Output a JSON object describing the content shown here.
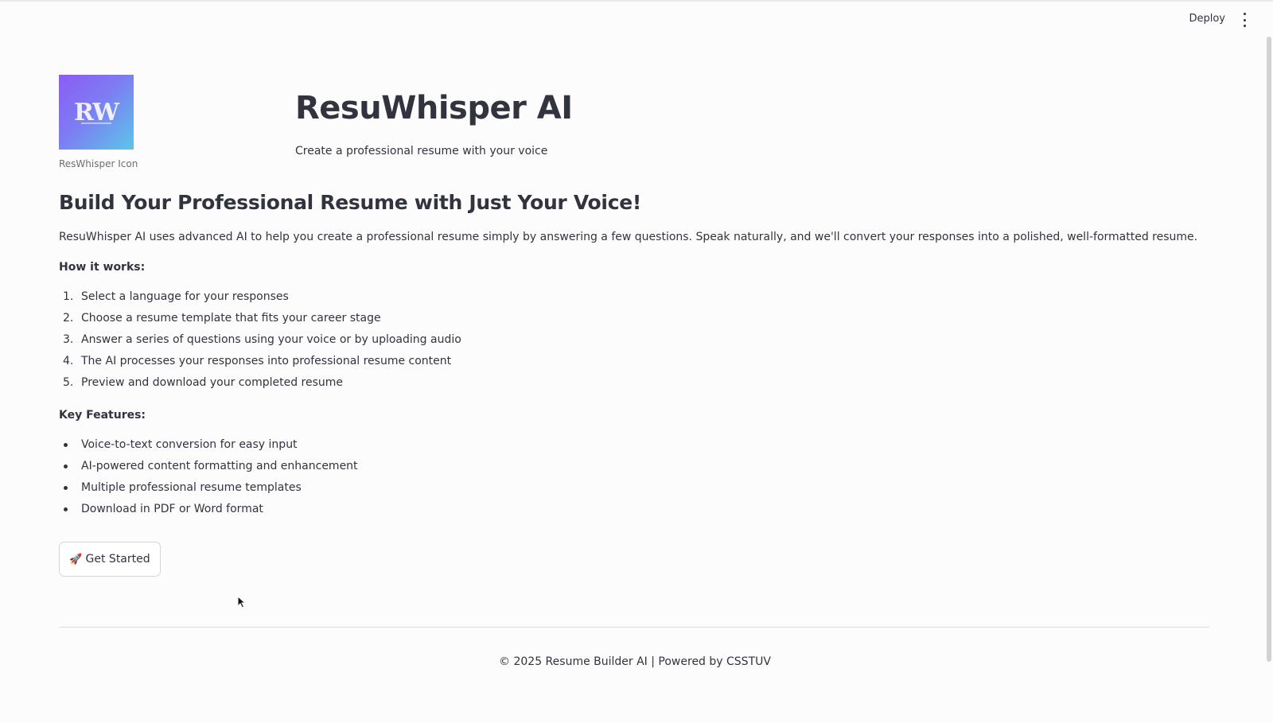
{
  "header": {
    "deploy_label": "Deploy",
    "menu_icon": "kebab-menu-icon"
  },
  "brand": {
    "logo_text": "RW",
    "logo_caption": "ResWhisper Icon",
    "app_title": "ResuWhisper AI",
    "app_subtitle": "Create a professional resume with your voice",
    "logo_gradient": [
      "#8b5cf6",
      "#5bc6e8"
    ]
  },
  "main": {
    "headline": "Build Your Professional Resume with Just Your Voice!",
    "intro": "ResuWhisper AI uses advanced AI to help you create a professional resume simply by answering a few questions. Speak naturally, and we'll convert your responses into a polished, well-formatted resume.",
    "how_label": "How it works:",
    "steps": [
      {
        "num": "1.",
        "text": "Select a language for your responses"
      },
      {
        "num": "2.",
        "text": "Choose a resume template that fits your career stage"
      },
      {
        "num": "3.",
        "text": "Answer a series of questions using your voice or by uploading audio"
      },
      {
        "num": "4.",
        "text": "The AI processes your responses into professional resume content"
      },
      {
        "num": "5.",
        "text": "Preview and download your completed resume"
      }
    ],
    "features_label": "Key Features:",
    "features": [
      "Voice-to-text conversion for easy input",
      "AI-powered content formatting and enhancement",
      "Multiple professional resume templates",
      "Download in PDF or Word format"
    ],
    "get_started": {
      "icon": "🚀",
      "label": "Get Started"
    }
  },
  "footer": {
    "text": "© 2025 Resume Builder AI | Powered by CSSTUV"
  }
}
